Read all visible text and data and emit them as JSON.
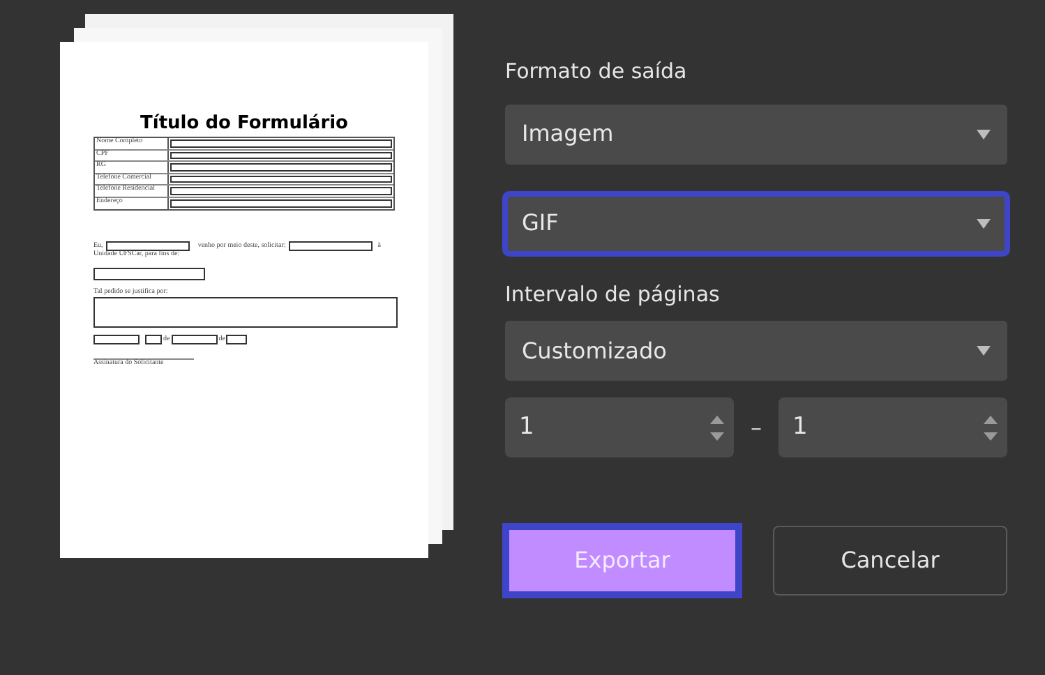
{
  "preview": {
    "title": "Título do Formulário",
    "fields": [
      "Nome Completo",
      "CPF",
      "RG",
      "Telefone Comercial",
      "Telefone Residencial",
      "Endereço"
    ],
    "sentence": {
      "start": "Eu,",
      "middle": "venho por meio deste, solicitar:",
      "end": "à",
      "line2": "Unidade UFSCar, para fins de:"
    },
    "justify_label": "Tal pedido se justifica por:",
    "date_words": [
      "de",
      "de"
    ],
    "signature": "Assinatura do Solicitante"
  },
  "output_format": {
    "label": "Formato de saída",
    "selects": [
      {
        "value": "Imagem",
        "focused": false
      },
      {
        "value": "GIF",
        "focused": true
      }
    ]
  },
  "page_range": {
    "label": "Intervalo de páginas",
    "select": {
      "value": "Customizado",
      "focused": false
    },
    "from": "1",
    "separator": "–",
    "to": "1"
  },
  "buttons": [
    {
      "label": "Exportar",
      "kind": "primary",
      "focused": true
    },
    {
      "label": "Cancelar",
      "kind": "secondary",
      "focused": false
    }
  ]
}
